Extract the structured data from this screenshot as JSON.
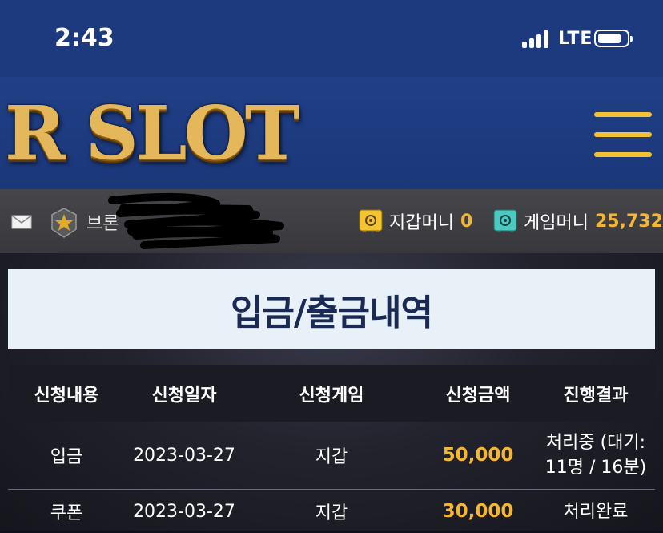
{
  "status_bar": {
    "time": "2:43",
    "network": "LTE"
  },
  "header": {
    "logo_text": "R SLOT",
    "menu_icon": "hamburger-menu-icon",
    "accent_color": "#f2c233"
  },
  "user_bar": {
    "mail_icon": "mail-icon",
    "rank_icon": "rank-star-badge-icon",
    "username_partial": "브론",
    "wallet": {
      "label": "지갑머니",
      "amount": "0"
    },
    "game_money": {
      "label": "게임머니",
      "amount": "25,732"
    }
  },
  "page": {
    "title": "입금/출금내역"
  },
  "table": {
    "headers": [
      "신청내용",
      "신청일자",
      "신청게임",
      "신청금액",
      "진행결과"
    ],
    "rows": [
      {
        "type": "입금",
        "date": "2023-03-27",
        "game": "지갑",
        "amount": "50,000",
        "status": "처리중 (대기: 11명 / 16분)"
      },
      {
        "type": "쿠폰",
        "date": "2023-03-27",
        "game": "지갑",
        "amount": "30,000",
        "status": "처리완료"
      }
    ]
  }
}
